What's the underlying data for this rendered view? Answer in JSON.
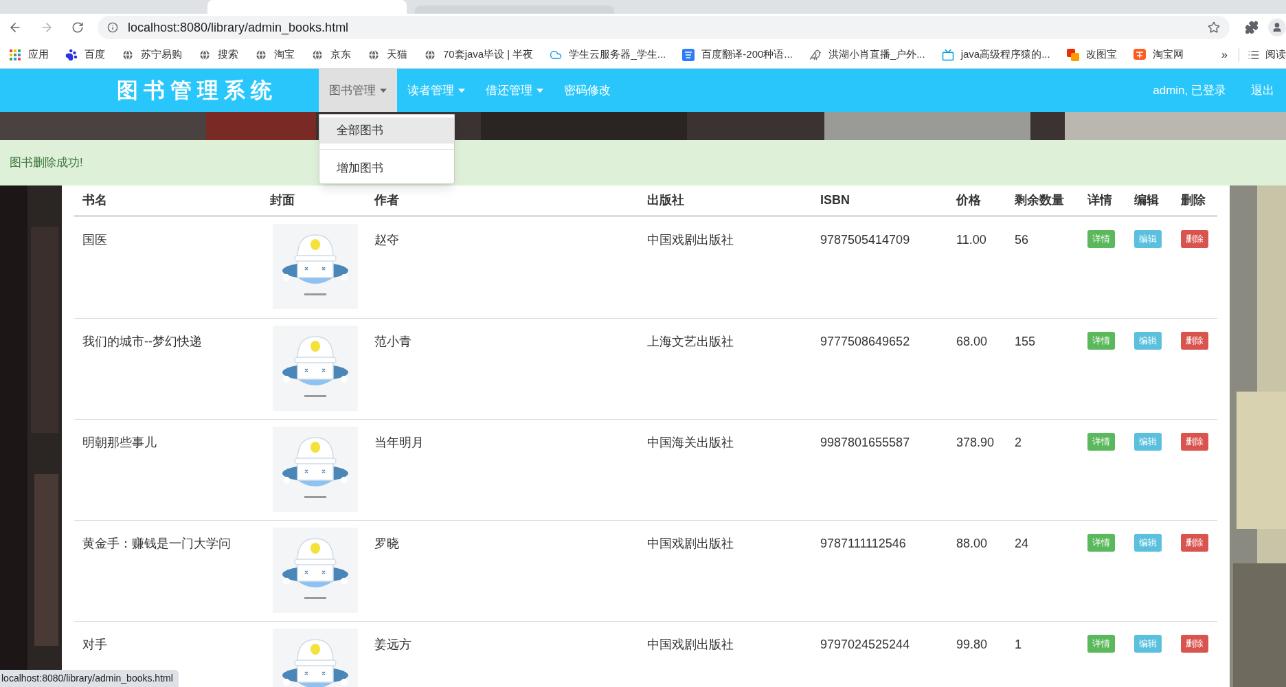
{
  "browser": {
    "url": "localhost:8080/library/admin_books.html",
    "bookmarks": [
      {
        "label": "应用",
        "kind": "apps"
      },
      {
        "label": "百度",
        "kind": "paw"
      },
      {
        "label": "苏宁易购",
        "kind": "globe"
      },
      {
        "label": "搜索",
        "kind": "globe"
      },
      {
        "label": "淘宝",
        "kind": "globe"
      },
      {
        "label": "京东",
        "kind": "globe"
      },
      {
        "label": "天猫",
        "kind": "globe"
      },
      {
        "label": "70套java毕设 | 半夜",
        "kind": "globe"
      },
      {
        "label": "学生云服务器_学生...",
        "kind": "cloud"
      },
      {
        "label": "百度翻译-200种语...",
        "kind": "translate"
      },
      {
        "label": "洪湖小肖直播_户外...",
        "kind": "bird"
      },
      {
        "label": "java高级程序猿的...",
        "kind": "tv"
      },
      {
        "label": "改图宝",
        "kind": "squares"
      },
      {
        "label": "淘宝网",
        "kind": "shop"
      }
    ],
    "more": "»",
    "reading_list": "阅读"
  },
  "navbar": {
    "brand": "图书管理系统",
    "menus": [
      {
        "label": "图书管理",
        "dropdown": true,
        "selected": true
      },
      {
        "label": "读者管理",
        "dropdown": true,
        "selected": false
      },
      {
        "label": "借还管理",
        "dropdown": true,
        "selected": false
      },
      {
        "label": "密码修改",
        "dropdown": false,
        "selected": false
      }
    ],
    "user": "admin, 已登录",
    "logout": "退出"
  },
  "dropdown": {
    "items": [
      {
        "label": "全部图书",
        "highlighted": true
      },
      {
        "label": "增加图书",
        "highlighted": false
      }
    ]
  },
  "alert": {
    "text": "图书删除成功!"
  },
  "table": {
    "columns": [
      "书名",
      "封面",
      "作者",
      "出版社",
      "ISBN",
      "价格",
      "剩余数量",
      "详情",
      "编辑",
      "删除"
    ],
    "rows": [
      {
        "title": "国医",
        "cover": {
          "kind": "picture"
        },
        "author": "赵夺",
        "publisher": "中国戏剧出版社",
        "isbn": "9787505414709",
        "price": "11.00",
        "stock": "56",
        "actions": [
          {
            "label": "详情",
            "kind": "detail"
          },
          {
            "label": "编辑",
            "kind": "edit"
          },
          {
            "label": "删除",
            "kind": "delete"
          }
        ]
      },
      {
        "title": "我们的城市--梦幻快递",
        "cover": {
          "kind": "picture"
        },
        "author": "范小青",
        "publisher": "上海文艺出版社",
        "isbn": "9777508649652",
        "price": "68.00",
        "stock": "155",
        "actions": [
          {
            "label": "详情",
            "kind": "detail"
          },
          {
            "label": "编辑",
            "kind": "edit"
          },
          {
            "label": "删除",
            "kind": "delete"
          }
        ]
      },
      {
        "title": "明朝那些事儿",
        "cover": {
          "kind": "picture"
        },
        "author": "当年明月",
        "publisher": "中国海关出版社",
        "isbn": "9987801655587",
        "price": "378.90",
        "stock": "2",
        "actions": [
          {
            "label": "详情",
            "kind": "detail"
          },
          {
            "label": "编辑",
            "kind": "edit"
          },
          {
            "label": "删除",
            "kind": "delete"
          }
        ]
      },
      {
        "title": "黄金手：赚钱是一门大学问",
        "cover": {
          "kind": "picture"
        },
        "author": "罗晓",
        "publisher": "中国戏剧出版社",
        "isbn": "9787111112546",
        "price": "88.00",
        "stock": "24",
        "actions": [
          {
            "label": "详情",
            "kind": "detail"
          },
          {
            "label": "编辑",
            "kind": "edit"
          },
          {
            "label": "删除",
            "kind": "delete"
          }
        ]
      },
      {
        "title": "对手",
        "cover": {
          "kind": "picture"
        },
        "author": "姜远方",
        "publisher": "中国戏剧出版社",
        "isbn": "9797024525244",
        "price": "99.80",
        "stock": "1",
        "actions": [
          {
            "label": "详情",
            "kind": "detail"
          },
          {
            "label": "编辑",
            "kind": "edit"
          },
          {
            "label": "删除",
            "kind": "delete"
          }
        ]
      }
    ]
  },
  "status_bar": {
    "url": "localhost:8080/library/admin_books.html"
  }
}
